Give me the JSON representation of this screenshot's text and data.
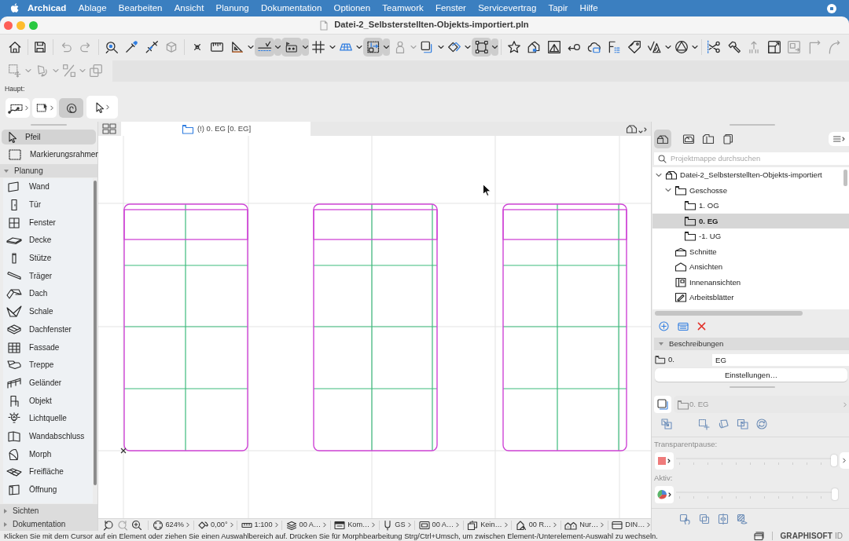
{
  "menu_bar": {
    "app": "Archicad",
    "items": [
      "Ablage",
      "Bearbeiten",
      "Ansicht",
      "Planung",
      "Dokumentation",
      "Optionen",
      "Teamwork",
      "Fenster",
      "Servicevertrag",
      "Tapir",
      "Hilfe"
    ]
  },
  "window": {
    "title": "Datei-2_Selbsterstellten-Objekts-importiert.pln"
  },
  "toolbar": {
    "row_1": [
      {
        "on": false,
        "disabled": false
      },
      {
        "on": false,
        "disabled": false
      },
      {
        "on": false,
        "disabled": true
      },
      {
        "on": false,
        "disabled": true
      },
      {
        "on": false,
        "disabled": false
      },
      {
        "on": false,
        "disabled": false
      },
      {
        "on": false,
        "disabled": false
      },
      {
        "on": false,
        "disabled": true
      },
      {
        "on": false,
        "disabled": false
      },
      {
        "on": false,
        "disabled": false
      },
      {
        "on": false,
        "disabled": false
      },
      {
        "on": true,
        "disabled": false
      },
      {
        "on": true,
        "disabled": false
      },
      {
        "on": false,
        "disabled": false
      },
      {
        "on": false,
        "disabled": false
      },
      {
        "on": true,
        "disabled": false
      },
      {
        "on": false,
        "disabled": true
      },
      {
        "on": false,
        "disabled": false
      },
      {
        "on": false,
        "disabled": false
      },
      {
        "on": true,
        "disabled": false
      },
      {
        "on": false,
        "disabled": false
      },
      {
        "on": false,
        "disabled": false
      },
      {
        "on": false,
        "disabled": false
      },
      {
        "on": false,
        "disabled": false
      },
      {
        "on": false,
        "disabled": false
      },
      {
        "on": false,
        "disabled": false
      },
      {
        "on": false,
        "disabled": false
      },
      {
        "on": false,
        "disabled": false
      },
      {
        "on": false,
        "disabled": false
      },
      {
        "on": false,
        "disabled": false
      },
      {
        "on": false,
        "disabled": false
      },
      {
        "on": false,
        "disabled": true
      },
      {
        "on": false,
        "disabled": false
      },
      {
        "on": false,
        "disabled": true
      },
      {
        "on": false,
        "disabled": true
      },
      {
        "on": false,
        "disabled": true
      }
    ],
    "row_2": [
      {
        "on": false,
        "disabled": true
      },
      {
        "on": false,
        "disabled": true
      },
      {
        "on": false,
        "disabled": true
      },
      {
        "on": false,
        "disabled": true
      }
    ]
  },
  "tool_palette": {
    "label": "Haupt:",
    "buttons": [
      {
        "on": false
      },
      {
        "on": false
      },
      {
        "on": true
      },
      {
        "on": false
      }
    ]
  },
  "toolbox": {
    "items": [
      {
        "label": "Pfeil",
        "selected": true
      },
      {
        "label": "Markierungsrahmen",
        "selected": false
      }
    ],
    "sections": [
      {
        "title": "Planung",
        "expanded": true,
        "items": [
          {
            "label": "Wand",
            "selected": false
          },
          {
            "label": "Tür",
            "selected": false
          },
          {
            "label": "Fenster",
            "selected": false
          },
          {
            "label": "Decke",
            "selected": false
          },
          {
            "label": "Stütze",
            "selected": false
          },
          {
            "label": "Träger",
            "selected": false
          },
          {
            "label": "Dach",
            "selected": false
          },
          {
            "label": "Schale",
            "selected": false
          },
          {
            "label": "Dachfenster",
            "selected": false
          },
          {
            "label": "Fassade",
            "selected": false
          },
          {
            "label": "Treppe",
            "selected": false
          },
          {
            "label": "Geländer",
            "selected": false
          },
          {
            "label": "Objekt",
            "selected": false
          },
          {
            "label": "Lichtquelle",
            "selected": false
          },
          {
            "label": "Wandabschluss",
            "selected": false
          },
          {
            "label": "Morph",
            "selected": false
          },
          {
            "label": "Freifläche",
            "selected": false
          },
          {
            "label": "Öffnung",
            "selected": false
          }
        ]
      },
      {
        "title": "Sichten",
        "expanded": false
      },
      {
        "title": "Dokumentation",
        "expanded": false
      }
    ]
  },
  "canvas": {
    "tab": "(!) 0. EG [0. EG]"
  },
  "view_bar": {
    "zoom_buttons": [
      {
        "disabled": false
      },
      {
        "disabled": true
      },
      {
        "disabled": false
      }
    ],
    "items": [
      "624%",
      "0,00°",
      "1:100",
      "00 A…",
      "Kom…",
      "GS",
      "00 A…",
      "Kein…",
      "00 R…",
      "Nur…",
      "DIN…"
    ]
  },
  "navigator": {
    "tabs": [
      {
        "selected": true
      },
      {
        "selected": false
      },
      {
        "selected": false
      },
      {
        "selected": false
      }
    ],
    "search": {
      "placeholder": "Projektmappe durchsuchen"
    },
    "tree": [
      {
        "label": "Datei-2_Selbsterstellten-Objekts-importiert",
        "kind": "project",
        "expanded": true,
        "selected": false,
        "children": [
          {
            "label": "Geschosse",
            "kind": "stories",
            "expanded": true,
            "selected": false,
            "children": [
              {
                "label": "1. OG",
                "kind": "story",
                "expanded": false,
                "selected": false
              },
              {
                "label": "0. EG",
                "kind": "story",
                "expanded": false,
                "selected": true
              },
              {
                "label": "-1. UG",
                "kind": "story",
                "expanded": false,
                "selected": false
              }
            ]
          },
          {
            "label": "Schnitte",
            "kind": "section",
            "expanded": false,
            "selected": false
          },
          {
            "label": "Ansichten",
            "kind": "elevation",
            "expanded": false,
            "selected": false
          },
          {
            "label": "Innenansichten",
            "kind": "interior",
            "expanded": false,
            "selected": false
          },
          {
            "label": "Arbeitsblätter",
            "kind": "worksheet",
            "expanded": false,
            "selected": false
          }
        ]
      }
    ]
  },
  "properties": {
    "section": {
      "title": "Beschreibungen",
      "expanded": true
    },
    "number": "0.",
    "name": "EG",
    "settings_button": "Einstellungen…",
    "story_select": {
      "value": "0. EG",
      "disabled": true
    },
    "trace": {
      "label": "Transparentpause:",
      "level": 1
    },
    "active": {
      "label": "Aktiv:",
      "level": 1
    }
  },
  "status_bar": {
    "message": "Klicken Sie mit dem Cursor auf ein Element oder ziehen Sie einen Auswahlbereich auf. Drücken Sie für Morphbearbeitung Strg/Ctrl+Umsch, um zwischen Element-/Unterelement-Auswahl zu wechseln.",
    "brand": "GRAPHISOFT",
    "brand_suffix": "ID"
  }
}
